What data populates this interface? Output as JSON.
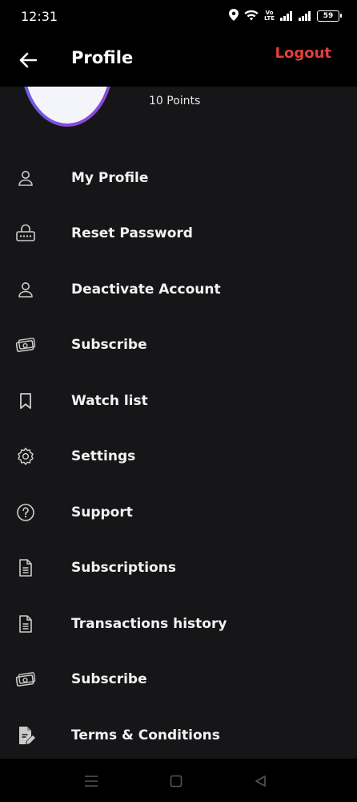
{
  "status_bar": {
    "time": "12:31",
    "volte_line1": "Vo",
    "volte_line2": "LTE",
    "battery": "59"
  },
  "header": {
    "title": "Profile",
    "logout_label": "Logout"
  },
  "profile": {
    "points": "10 Points"
  },
  "menu": {
    "items": [
      {
        "label": "My Profile",
        "icon": "person-icon"
      },
      {
        "label": "Reset Password",
        "icon": "lock-icon"
      },
      {
        "label": "Deactivate Account",
        "icon": "person-icon"
      },
      {
        "label": "Subscribe",
        "icon": "money-icon"
      },
      {
        "label": "Watch list",
        "icon": "bookmark-icon"
      },
      {
        "label": "Settings",
        "icon": "gear-icon"
      },
      {
        "label": "Support",
        "icon": "help-icon"
      },
      {
        "label": "Subscriptions",
        "icon": "document-icon"
      },
      {
        "label": "Transactions history",
        "icon": "document-icon"
      },
      {
        "label": "Subscribe",
        "icon": "money-icon"
      },
      {
        "label": "Terms & Conditions",
        "icon": "document-edit-icon"
      }
    ]
  },
  "colors": {
    "accent": "#e0413b",
    "background": "#161618",
    "bar": "#000000"
  }
}
